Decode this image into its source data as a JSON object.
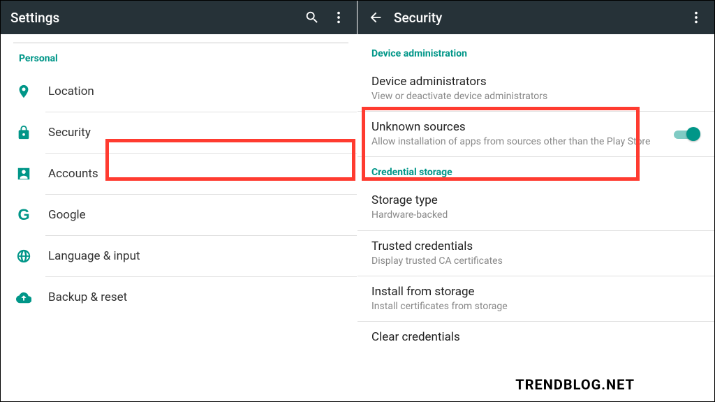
{
  "left": {
    "title": "Settings",
    "section": "Personal",
    "items": [
      {
        "label": "Location"
      },
      {
        "label": "Security"
      },
      {
        "label": "Accounts"
      },
      {
        "label": "Google"
      },
      {
        "label": "Language & input"
      },
      {
        "label": "Backup & reset"
      }
    ]
  },
  "right": {
    "title": "Security",
    "sections": {
      "device_admin": {
        "header": "Device administration",
        "admins": {
          "title": "Device administrators",
          "sub": "View or deactivate device administrators"
        },
        "unknown": {
          "title": "Unknown sources",
          "sub": "Allow installation of apps from sources other than the Play Store",
          "enabled": true
        }
      },
      "cred": {
        "header": "Credential storage",
        "storage": {
          "title": "Storage type",
          "sub": "Hardware-backed"
        },
        "trusted": {
          "title": "Trusted credentials",
          "sub": "Display trusted CA certificates"
        },
        "install": {
          "title": "Install from storage",
          "sub": "Install certificates from storage"
        },
        "clear": {
          "title": "Clear credentials"
        }
      }
    }
  },
  "watermark": "TRENDBLOG.NET"
}
